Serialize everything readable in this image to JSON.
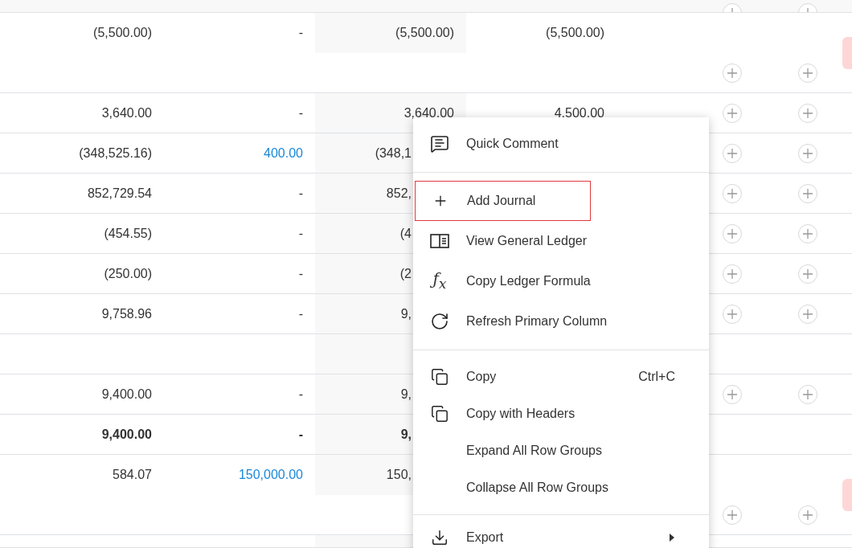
{
  "table": {
    "rows": [
      {
        "kind": "partial",
        "cells": [],
        "add_buttons": true,
        "flagged": false
      },
      {
        "kind": "tall",
        "cells": [
          {
            "text": "(5,500.00)",
            "link": false
          },
          {
            "text": "-",
            "link": false
          },
          {
            "text": "(5,500.00)",
            "link": false
          },
          {
            "text": "(5,500.00)",
            "link": false
          }
        ],
        "add_buttons": true,
        "flagged": true,
        "bold": false
      },
      {
        "kind": "line",
        "cells": [
          {
            "text": "3,640.00",
            "link": false
          },
          {
            "text": "-",
            "link": false
          },
          {
            "text": "3,640.00",
            "link": false
          },
          {
            "text": "4,500.00",
            "link": false
          }
        ],
        "add_buttons": true,
        "flagged": false,
        "bold": false
      },
      {
        "kind": "line",
        "cells": [
          {
            "text": "(348,525.16)",
            "link": false
          },
          {
            "text": "400.00",
            "link": true
          },
          {
            "text": "(348,1",
            "link": false
          }
        ],
        "add_buttons": true,
        "flagged": false,
        "bold": false
      },
      {
        "kind": "line",
        "cells": [
          {
            "text": "852,729.54",
            "link": false
          },
          {
            "text": "-",
            "link": false
          },
          {
            "text": "852,",
            "link": false
          }
        ],
        "add_buttons": true,
        "flagged": false,
        "bold": false
      },
      {
        "kind": "line",
        "cells": [
          {
            "text": "(454.55)",
            "link": false
          },
          {
            "text": "-",
            "link": false
          },
          {
            "text": "(4",
            "link": false
          }
        ],
        "add_buttons": true,
        "flagged": false,
        "bold": false
      },
      {
        "kind": "line",
        "cells": [
          {
            "text": "(250.00)",
            "link": false
          },
          {
            "text": "-",
            "link": false
          },
          {
            "text": "(2",
            "link": false
          }
        ],
        "add_buttons": true,
        "flagged": false,
        "bold": false
      },
      {
        "kind": "line",
        "cells": [
          {
            "text": "9,758.96",
            "link": false
          },
          {
            "text": "-",
            "link": false
          },
          {
            "text": "9,",
            "link": false
          }
        ],
        "add_buttons": true,
        "flagged": false,
        "bold": false
      },
      {
        "kind": "line",
        "cells": [],
        "add_buttons": false,
        "flagged": false
      },
      {
        "kind": "line",
        "cells": [
          {
            "text": "9,400.00",
            "link": false
          },
          {
            "text": "-",
            "link": false
          },
          {
            "text": "9,",
            "link": false
          }
        ],
        "add_buttons": true,
        "flagged": false,
        "bold": false
      },
      {
        "kind": "line",
        "cells": [
          {
            "text": "9,400.00",
            "link": false
          },
          {
            "text": "-",
            "link": false
          },
          {
            "text": "9,",
            "link": false
          }
        ],
        "add_buttons": false,
        "flagged": false,
        "bold": true
      },
      {
        "kind": "tall",
        "cells": [
          {
            "text": "584.07",
            "link": false
          },
          {
            "text": "150,000.00",
            "link": true
          },
          {
            "text": "150,",
            "link": false
          }
        ],
        "add_buttons": true,
        "flagged": true,
        "bold": false
      },
      {
        "kind": "partial",
        "cells": [],
        "add_buttons": false,
        "flagged": false
      }
    ]
  },
  "context_menu": {
    "groups": [
      [
        {
          "label": "Quick Comment",
          "outlined": false,
          "submenu": false
        }
      ],
      [
        {
          "label": "Add Journal",
          "outlined": true,
          "submenu": false
        },
        {
          "label": "View General Ledger",
          "outlined": false,
          "submenu": false
        },
        {
          "label": "Copy Ledger Formula",
          "glyph": "ƒ$_{x}$",
          "outlined": false,
          "submenu": false
        },
        {
          "label": "Refresh Primary Column",
          "outlined": false,
          "submenu": false
        }
      ],
      [
        {
          "label": "Copy",
          "shortcut": "Ctrl+C",
          "outlined": false,
          "submenu": false
        },
        {
          "label": "Copy with Headers",
          "outlined": false,
          "submenu": false
        },
        {
          "label": "Expand All Row Groups",
          "outlined": false,
          "submenu": false
        },
        {
          "label": "Collapse All Row Groups",
          "outlined": false,
          "submenu": false
        }
      ],
      [
        {
          "label": "Export",
          "outlined": false,
          "submenu": true
        }
      ]
    ]
  }
}
